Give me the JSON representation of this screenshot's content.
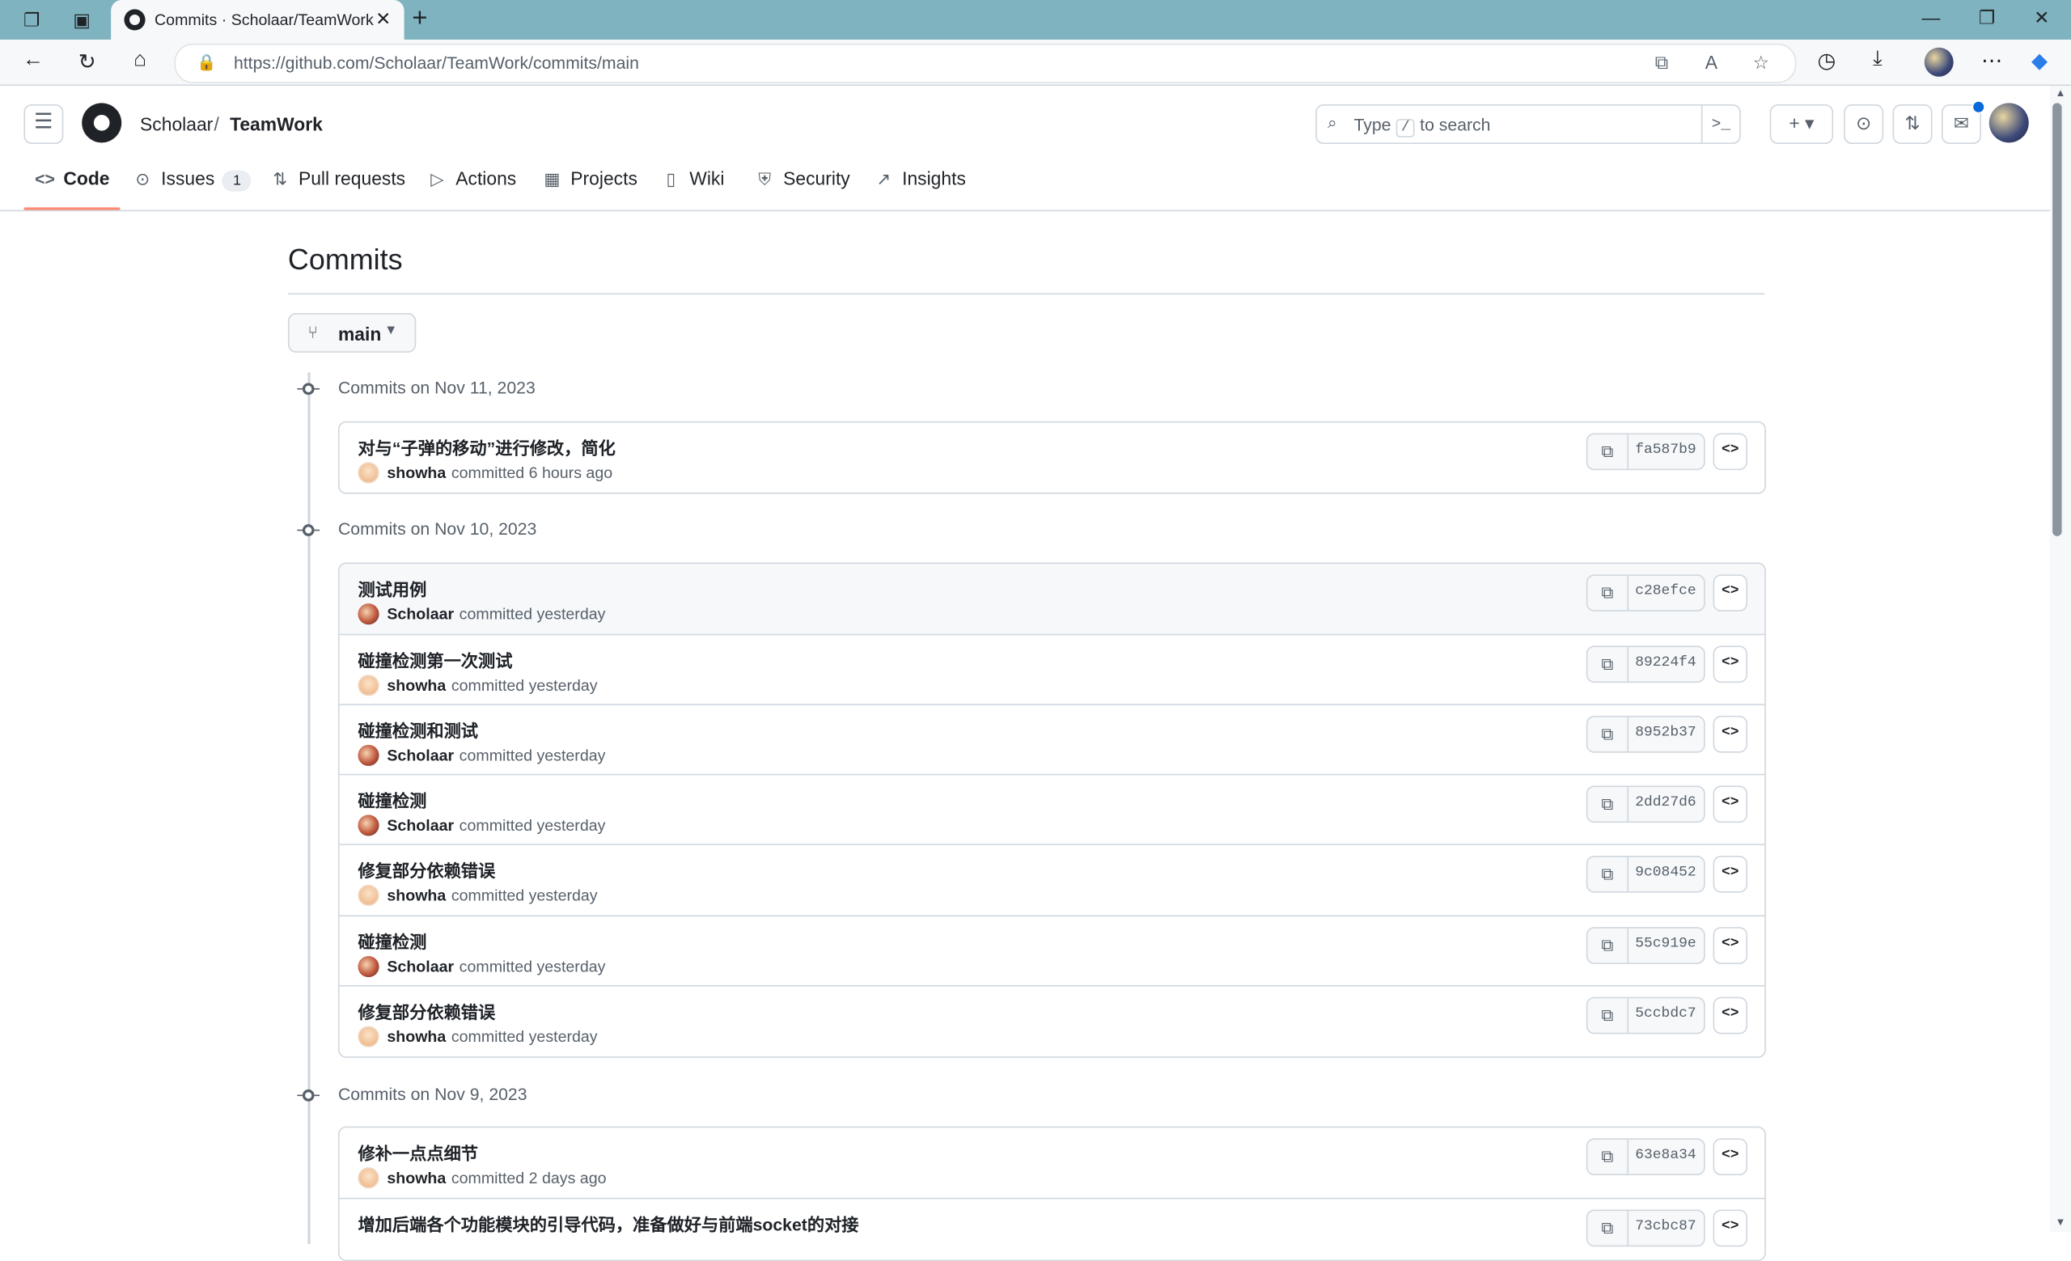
{
  "browser": {
    "tab_title": "Commits · Scholaar/TeamWork",
    "url": "https://github.com/Scholaar/TeamWork/commits/main",
    "new_tab": "+",
    "close": "✕"
  },
  "header": {
    "owner": "Scholaar",
    "separator": "/",
    "repo": "TeamWork",
    "search_prefix": "Type",
    "search_key": "/",
    "search_suffix": "to search",
    "command": ">_"
  },
  "repo_nav": [
    {
      "label": "Code",
      "icon": "code-icon",
      "active": true
    },
    {
      "label": "Issues",
      "icon": "issue-icon",
      "count": "1"
    },
    {
      "label": "Pull requests",
      "icon": "pull-request-icon"
    },
    {
      "label": "Actions",
      "icon": "play-icon"
    },
    {
      "label": "Projects",
      "icon": "table-icon"
    },
    {
      "label": "Wiki",
      "icon": "book-icon"
    },
    {
      "label": "Security",
      "icon": "shield-icon"
    },
    {
      "label": "Insights",
      "icon": "graph-icon"
    }
  ],
  "page": {
    "title": "Commits",
    "branch": "main"
  },
  "days": [
    {
      "label": "Commits on Nov 11, 2023",
      "commits": [
        {
          "message": "对与“子弹的移动”进行修改，简化",
          "author": "showha",
          "time": "committed 6 hours ago",
          "sha": "fa587b9",
          "avatar": "showha"
        }
      ]
    },
    {
      "label": "Commits on Nov 10, 2023",
      "commits": [
        {
          "message": "测试用例",
          "author": "Scholaar",
          "time": "committed yesterday",
          "sha": "c28efce",
          "avatar": "scholaar"
        },
        {
          "message": "碰撞检测第一次测试",
          "author": "showha",
          "time": "committed yesterday",
          "sha": "89224f4",
          "avatar": "showha"
        },
        {
          "message": "碰撞检测和测试",
          "author": "Scholaar",
          "time": "committed yesterday",
          "sha": "8952b37",
          "avatar": "scholaar"
        },
        {
          "message": "碰撞检测",
          "author": "Scholaar",
          "time": "committed yesterday",
          "sha": "2dd27d6",
          "avatar": "scholaar"
        },
        {
          "message": "修复部分依赖错误",
          "author": "showha",
          "time": "committed yesterday",
          "sha": "9c08452",
          "avatar": "showha"
        },
        {
          "message": "碰撞检测",
          "author": "Scholaar",
          "time": "committed yesterday",
          "sha": "55c919e",
          "avatar": "scholaar"
        },
        {
          "message": "修复部分依赖错误",
          "author": "showha",
          "time": "committed yesterday",
          "sha": "5ccbdc7",
          "avatar": "showha"
        }
      ]
    },
    {
      "label": "Commits on Nov 9, 2023",
      "commits": [
        {
          "message": "修补一点点细节",
          "author": "showha",
          "time": "committed 2 days ago",
          "sha": "63e8a34",
          "avatar": "showha"
        },
        {
          "message": "增加后端各个功能模块的引导代码，准备做好与前端socket的对接",
          "author": "",
          "time": "",
          "sha": "73cbc87",
          "avatar": "showha"
        }
      ]
    }
  ],
  "colors": {
    "accent_underline": "#fd8c73",
    "border": "#d0d7de",
    "muted": "#57606a",
    "chrome": "#7fb3bf"
  }
}
